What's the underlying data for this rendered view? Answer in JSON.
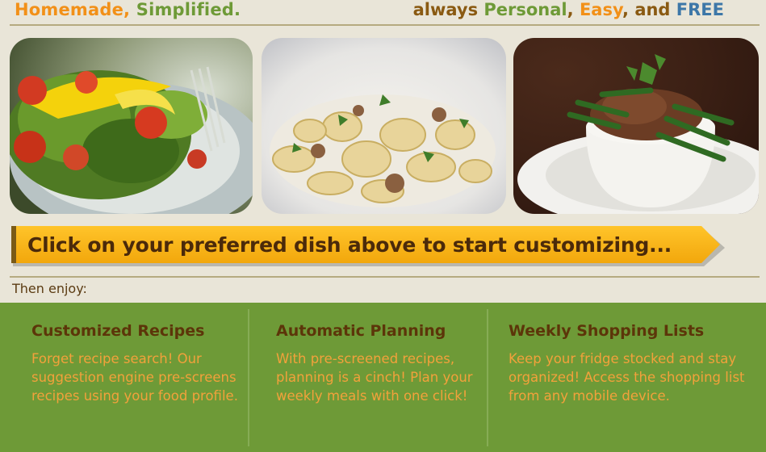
{
  "header": {
    "left": {
      "part1": "Homemade,",
      "part2": "Simplified."
    },
    "right": {
      "w1": "always",
      "w2": "Personal",
      "sep1": ",",
      "w3": "Easy",
      "sep2": ",",
      "w4": "and",
      "w5": "FREE"
    }
  },
  "dishes": [
    {
      "name": "salad-dish"
    },
    {
      "name": "pasta-dish"
    },
    {
      "name": "beef-rice-dish"
    }
  ],
  "cta": {
    "text": "Click on your preferred dish above to start customizing..."
  },
  "then_enjoy": "Then enjoy:",
  "features": [
    {
      "title": "Customized Recipes",
      "body": "Forget recipe search!  Our suggestion engine pre-screens recipes using your food profile."
    },
    {
      "title": "Automatic Planning",
      "body": "With pre-screened recipes, planning is a cinch! Plan your weekly meals with one click!"
    },
    {
      "title": "Weekly Shopping Lists",
      "body": "Keep your fridge stocked and stay organized! Access the shopping list from any mobile device."
    }
  ],
  "colors": {
    "background": "#e9e5d8",
    "orange": "#f29018",
    "green": "#6e9a37",
    "brown": "#8a5a12",
    "blue": "#3d77a8",
    "cta_yellow": "#f7b21a",
    "feature_text": "#f2a13b"
  }
}
